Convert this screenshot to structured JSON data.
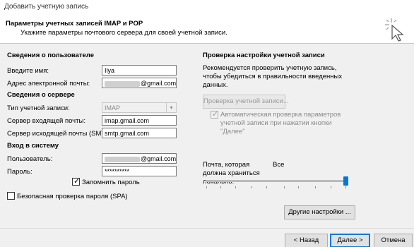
{
  "window": {
    "title": "Добавить учетную запись"
  },
  "header": {
    "title": "Параметры учетных записей IMAP и POP",
    "subtitle": "Укажите параметры почтового сервера для своей учетной записи."
  },
  "user_info": {
    "section": "Сведения о пользователе",
    "name_label": "Введите имя:",
    "name_value": "Ilya",
    "email_label": "Адрес электронной почты:",
    "email_suffix": "@gmail.com"
  },
  "server_info": {
    "section": "Сведения о сервере",
    "account_type_label": "Тип учетной записи:",
    "account_type_value": "IMAP",
    "incoming_label": "Сервер входящей почты:",
    "incoming_value": "imap.gmail.com",
    "outgoing_label": "Сервер исходящей почты (SMTP):",
    "outgoing_value": "smtp.gmail.com"
  },
  "logon": {
    "section": "Вход в систему",
    "user_label": "Пользователь:",
    "user_suffix": "@gmail.com",
    "password_label": "Пароль:",
    "password_value": "**********",
    "remember_label": "Запомнить пароль",
    "remember_checked": true,
    "spa_label": "Безопасная проверка пароля (SPA)",
    "spa_checked": false
  },
  "test": {
    "section": "Проверка настройки учетной записи",
    "description": "Рекомендуется проверить учетную запись, чтобы убедиться в правильности введенных данных.",
    "test_button": "Проверка учетной записи...",
    "auto_test_label": "Автоматическая проверка параметров учетной записи при нажатии кнопки \"Далее\"",
    "auto_test_checked": true
  },
  "offline": {
    "label": "Почта, которая должна храниться локально:",
    "value": "Все",
    "slider_position_fraction": 1.0
  },
  "more_settings_button": "Другие настройки ...",
  "footer": {
    "back": "< Назад",
    "next": "Далее >",
    "cancel": "Отмена"
  },
  "colors": {
    "accent": "#0078d7",
    "background": "#f0f0f0"
  }
}
